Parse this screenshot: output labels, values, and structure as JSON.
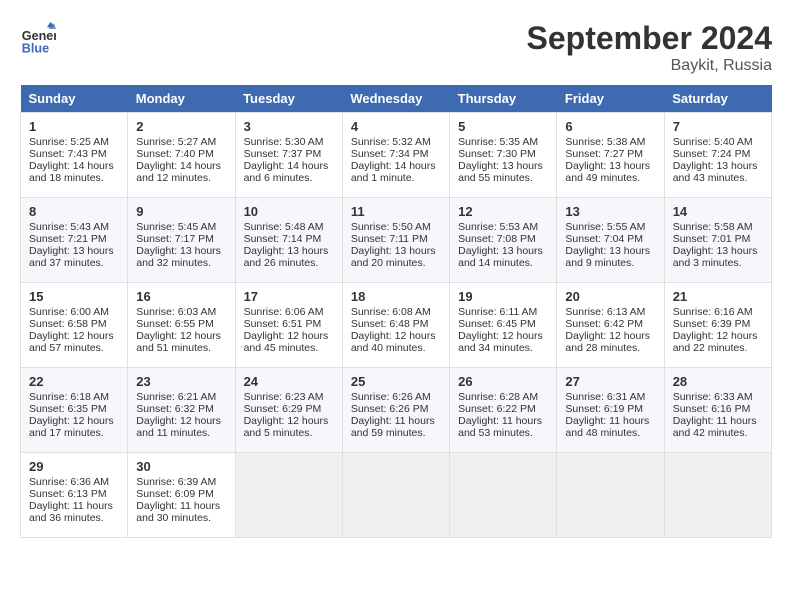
{
  "header": {
    "logo_line1": "General",
    "logo_line2": "Blue",
    "month_year": "September 2024",
    "location": "Baykit, Russia"
  },
  "days_of_week": [
    "Sunday",
    "Monday",
    "Tuesday",
    "Wednesday",
    "Thursday",
    "Friday",
    "Saturday"
  ],
  "weeks": [
    [
      {
        "day": "1",
        "sunrise": "Sunrise: 5:25 AM",
        "sunset": "Sunset: 7:43 PM",
        "daylight": "Daylight: 14 hours and 18 minutes."
      },
      {
        "day": "2",
        "sunrise": "Sunrise: 5:27 AM",
        "sunset": "Sunset: 7:40 PM",
        "daylight": "Daylight: 14 hours and 12 minutes."
      },
      {
        "day": "3",
        "sunrise": "Sunrise: 5:30 AM",
        "sunset": "Sunset: 7:37 PM",
        "daylight": "Daylight: 14 hours and 6 minutes."
      },
      {
        "day": "4",
        "sunrise": "Sunrise: 5:32 AM",
        "sunset": "Sunset: 7:34 PM",
        "daylight": "Daylight: 14 hours and 1 minute."
      },
      {
        "day": "5",
        "sunrise": "Sunrise: 5:35 AM",
        "sunset": "Sunset: 7:30 PM",
        "daylight": "Daylight: 13 hours and 55 minutes."
      },
      {
        "day": "6",
        "sunrise": "Sunrise: 5:38 AM",
        "sunset": "Sunset: 7:27 PM",
        "daylight": "Daylight: 13 hours and 49 minutes."
      },
      {
        "day": "7",
        "sunrise": "Sunrise: 5:40 AM",
        "sunset": "Sunset: 7:24 PM",
        "daylight": "Daylight: 13 hours and 43 minutes."
      }
    ],
    [
      {
        "day": "8",
        "sunrise": "Sunrise: 5:43 AM",
        "sunset": "Sunset: 7:21 PM",
        "daylight": "Daylight: 13 hours and 37 minutes."
      },
      {
        "day": "9",
        "sunrise": "Sunrise: 5:45 AM",
        "sunset": "Sunset: 7:17 PM",
        "daylight": "Daylight: 13 hours and 32 minutes."
      },
      {
        "day": "10",
        "sunrise": "Sunrise: 5:48 AM",
        "sunset": "Sunset: 7:14 PM",
        "daylight": "Daylight: 13 hours and 26 minutes."
      },
      {
        "day": "11",
        "sunrise": "Sunrise: 5:50 AM",
        "sunset": "Sunset: 7:11 PM",
        "daylight": "Daylight: 13 hours and 20 minutes."
      },
      {
        "day": "12",
        "sunrise": "Sunrise: 5:53 AM",
        "sunset": "Sunset: 7:08 PM",
        "daylight": "Daylight: 13 hours and 14 minutes."
      },
      {
        "day": "13",
        "sunrise": "Sunrise: 5:55 AM",
        "sunset": "Sunset: 7:04 PM",
        "daylight": "Daylight: 13 hours and 9 minutes."
      },
      {
        "day": "14",
        "sunrise": "Sunrise: 5:58 AM",
        "sunset": "Sunset: 7:01 PM",
        "daylight": "Daylight: 13 hours and 3 minutes."
      }
    ],
    [
      {
        "day": "15",
        "sunrise": "Sunrise: 6:00 AM",
        "sunset": "Sunset: 6:58 PM",
        "daylight": "Daylight: 12 hours and 57 minutes."
      },
      {
        "day": "16",
        "sunrise": "Sunrise: 6:03 AM",
        "sunset": "Sunset: 6:55 PM",
        "daylight": "Daylight: 12 hours and 51 minutes."
      },
      {
        "day": "17",
        "sunrise": "Sunrise: 6:06 AM",
        "sunset": "Sunset: 6:51 PM",
        "daylight": "Daylight: 12 hours and 45 minutes."
      },
      {
        "day": "18",
        "sunrise": "Sunrise: 6:08 AM",
        "sunset": "Sunset: 6:48 PM",
        "daylight": "Daylight: 12 hours and 40 minutes."
      },
      {
        "day": "19",
        "sunrise": "Sunrise: 6:11 AM",
        "sunset": "Sunset: 6:45 PM",
        "daylight": "Daylight: 12 hours and 34 minutes."
      },
      {
        "day": "20",
        "sunrise": "Sunrise: 6:13 AM",
        "sunset": "Sunset: 6:42 PM",
        "daylight": "Daylight: 12 hours and 28 minutes."
      },
      {
        "day": "21",
        "sunrise": "Sunrise: 6:16 AM",
        "sunset": "Sunset: 6:39 PM",
        "daylight": "Daylight: 12 hours and 22 minutes."
      }
    ],
    [
      {
        "day": "22",
        "sunrise": "Sunrise: 6:18 AM",
        "sunset": "Sunset: 6:35 PM",
        "daylight": "Daylight: 12 hours and 17 minutes."
      },
      {
        "day": "23",
        "sunrise": "Sunrise: 6:21 AM",
        "sunset": "Sunset: 6:32 PM",
        "daylight": "Daylight: 12 hours and 11 minutes."
      },
      {
        "day": "24",
        "sunrise": "Sunrise: 6:23 AM",
        "sunset": "Sunset: 6:29 PM",
        "daylight": "Daylight: 12 hours and 5 minutes."
      },
      {
        "day": "25",
        "sunrise": "Sunrise: 6:26 AM",
        "sunset": "Sunset: 6:26 PM",
        "daylight": "Daylight: 11 hours and 59 minutes."
      },
      {
        "day": "26",
        "sunrise": "Sunrise: 6:28 AM",
        "sunset": "Sunset: 6:22 PM",
        "daylight": "Daylight: 11 hours and 53 minutes."
      },
      {
        "day": "27",
        "sunrise": "Sunrise: 6:31 AM",
        "sunset": "Sunset: 6:19 PM",
        "daylight": "Daylight: 11 hours and 48 minutes."
      },
      {
        "day": "28",
        "sunrise": "Sunrise: 6:33 AM",
        "sunset": "Sunset: 6:16 PM",
        "daylight": "Daylight: 11 hours and 42 minutes."
      }
    ],
    [
      {
        "day": "29",
        "sunrise": "Sunrise: 6:36 AM",
        "sunset": "Sunset: 6:13 PM",
        "daylight": "Daylight: 11 hours and 36 minutes."
      },
      {
        "day": "30",
        "sunrise": "Sunrise: 6:39 AM",
        "sunset": "Sunset: 6:09 PM",
        "daylight": "Daylight: 11 hours and 30 minutes."
      },
      null,
      null,
      null,
      null,
      null
    ]
  ]
}
